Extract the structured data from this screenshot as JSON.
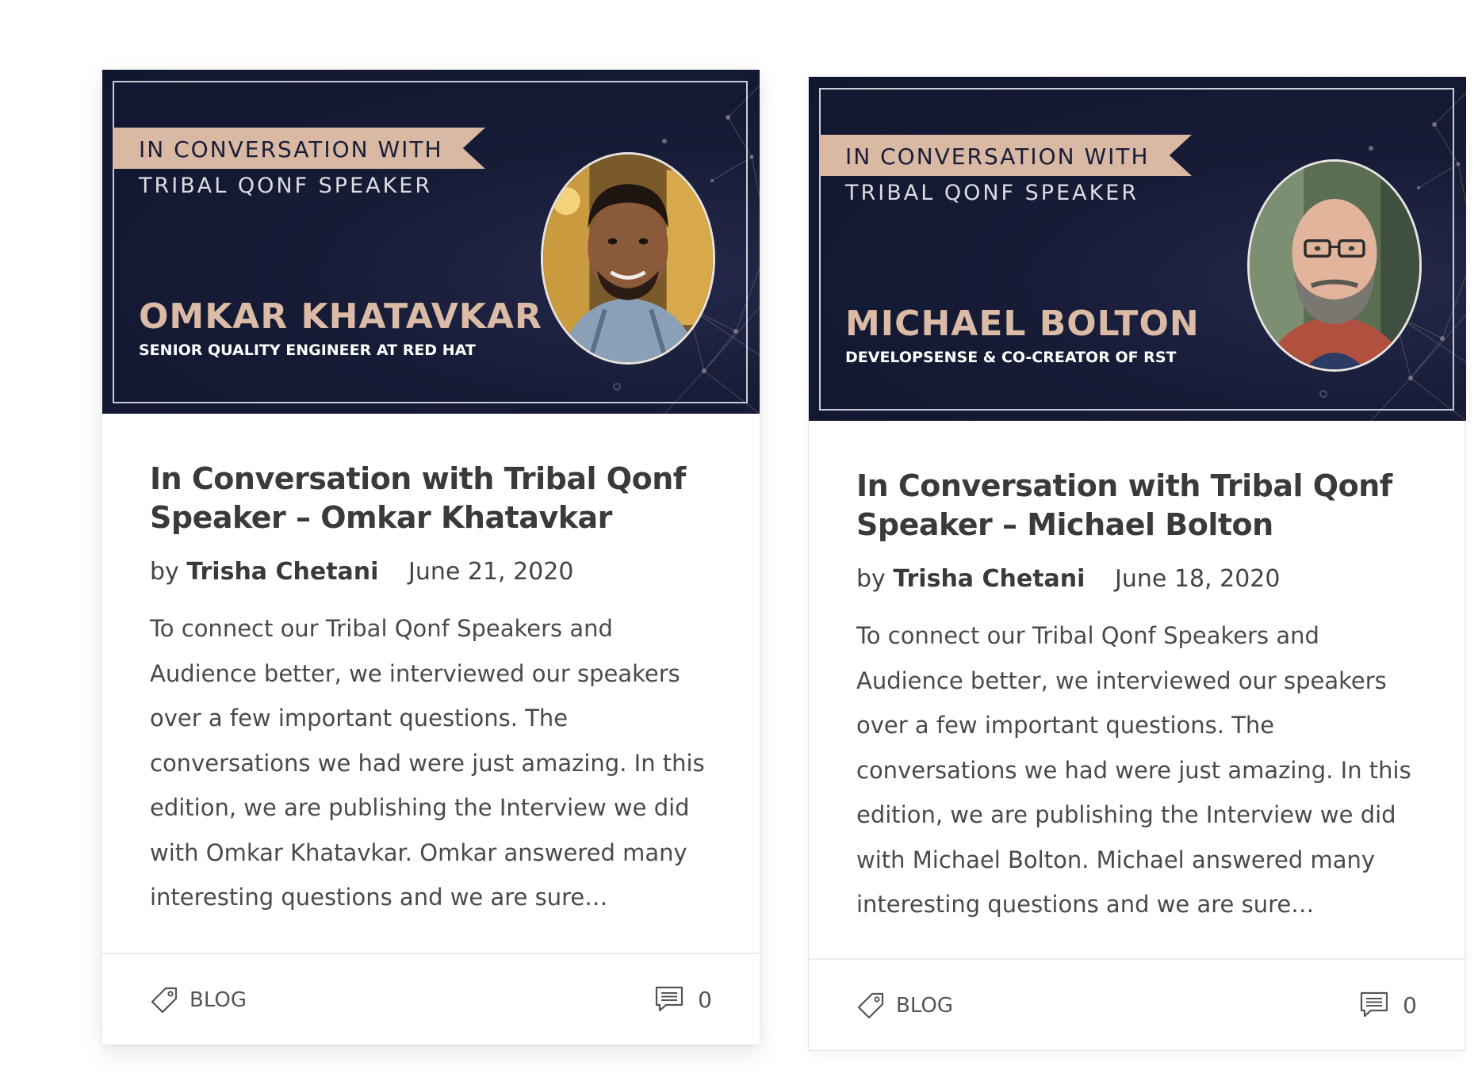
{
  "posts": [
    {
      "banner": {
        "ribbon": "IN CONVERSATION WITH",
        "subtitle": "TRIBAL QONF SPEAKER",
        "name": "OMKAR KHATAVKAR",
        "role": "SENIOR QUALITY ENGINEER AT RED HAT"
      },
      "title": "In Conversation with Tribal Qonf Speaker – Omkar Khatavkar",
      "by": "by",
      "author": "Trisha Chetani",
      "date": "June 21, 2020",
      "excerpt": "To connect our Tribal Qonf Speakers and Audience better, we interviewed our speakers over a few important questions. The conversations we had were just amazing.  In this edition, we are publishing the Interview we did with Omkar Khatavkar. Omkar answered many interesting questions and we are sure…",
      "category": "BLOG",
      "comment_count": "0"
    },
    {
      "banner": {
        "ribbon": "IN CONVERSATION WITH",
        "subtitle": "TRIBAL QONF SPEAKER",
        "name": "MICHAEL BOLTON",
        "role": "DEVELOPSENSE & CO-CREATOR OF RST"
      },
      "title": "In Conversation with Tribal Qonf Speaker – Michael Bolton",
      "by": "by",
      "author": "Trisha Chetani",
      "date": "June 18, 2020",
      "excerpt": "To connect our Tribal Qonf Speakers and Audience better, we interviewed our speakers over a few important questions. The conversations we had were just amazing.  In this edition, we are publishing the Interview we did with Michael Bolton. Michael answered many interesting questions and we are sure…",
      "category": "BLOG",
      "comment_count": "0"
    }
  ],
  "icons": {
    "category": "tag-icon",
    "comments": "comment-icon"
  },
  "colors": {
    "banner_bg": "#161b36",
    "ribbon": "#d9b9a3",
    "speaker_name": "#dcbba6",
    "title_text": "#3a3a3a",
    "body_text": "#4a4a4a"
  }
}
